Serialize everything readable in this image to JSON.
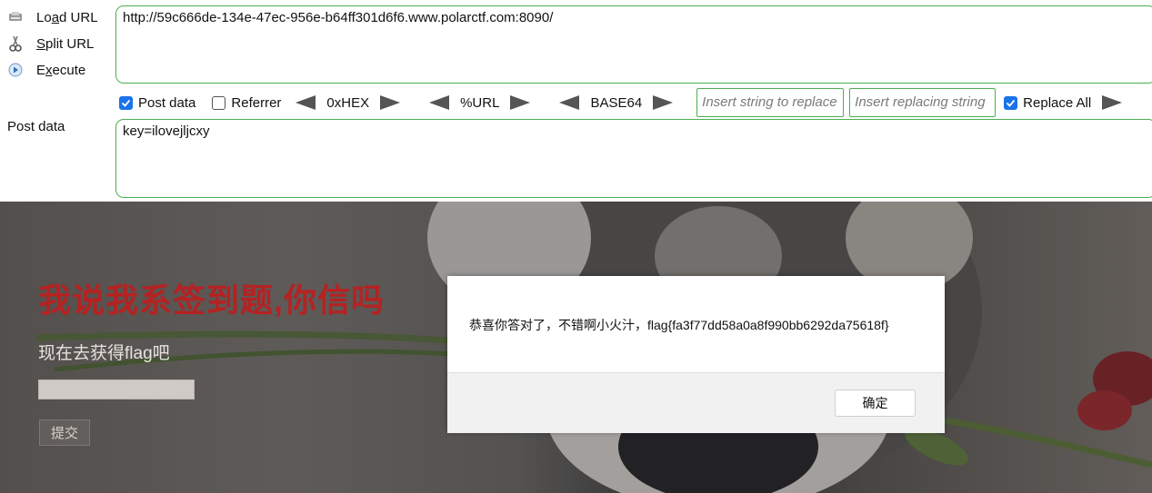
{
  "hackbar": {
    "actions": [
      {
        "label_pre": "Lo",
        "label_ul": "a",
        "label_post": "d URL",
        "icon": "load-url-icon"
      },
      {
        "label_pre": "",
        "label_ul": "S",
        "label_post": "plit URL",
        "icon": "scissors-icon"
      },
      {
        "label_pre": "E",
        "label_ul": "x",
        "label_post": "ecute",
        "icon": "play-icon"
      }
    ],
    "url": "http://59c666de-134e-47ec-956e-b64ff301d6f6.www.polarctf.com:8090/",
    "toolbar": {
      "post_data": {
        "label": "Post data",
        "checked": true
      },
      "referrer": {
        "label": "Referrer",
        "checked": false
      },
      "hex": "0xHEX",
      "url_enc": "%URL",
      "base64": "BASE64",
      "replace_from_placeholder": "Insert string to replace",
      "replace_to_placeholder": "Insert replacing string",
      "replace_all": {
        "label": "Replace All",
        "checked": true
      }
    },
    "post_label": "Post data",
    "post_body": "key=ilovejljcxy"
  },
  "page": {
    "title": "我说我系签到题,你信吗",
    "subtitle": "现在去获得flag吧",
    "submit": "提交"
  },
  "dialog": {
    "message": "恭喜你答对了，不错啊小火汁，flag{fa3f77dd58a0a8f990bb6292da75618f}",
    "ok": "确定"
  },
  "colors": {
    "accent_border": "#4caf50",
    "checkbox": "#1a73e8",
    "title_red": "#b52222"
  }
}
